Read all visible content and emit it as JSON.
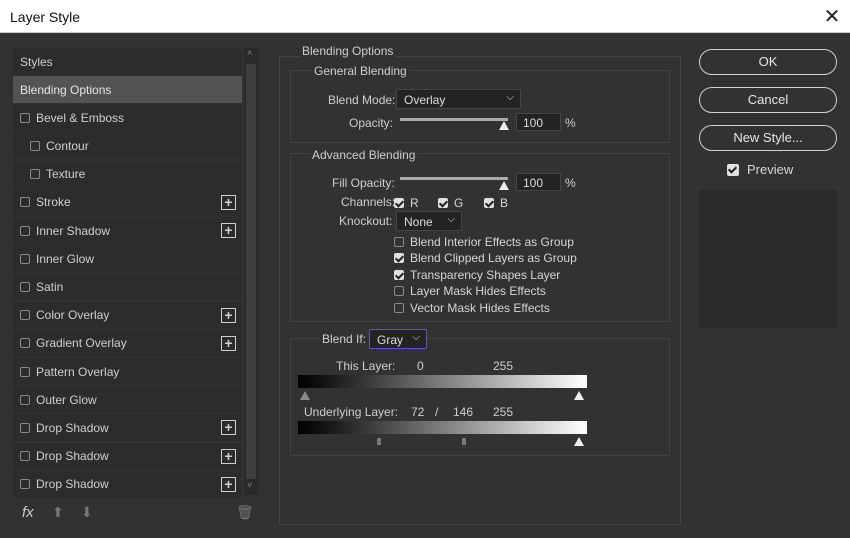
{
  "window": {
    "title": "Layer Style",
    "close_icon": "close-icon"
  },
  "styles_list": {
    "header": "Styles",
    "items": [
      {
        "label": "Blending Options",
        "selected": true
      },
      {
        "label": "Bevel & Emboss",
        "checkbox": true
      },
      {
        "label": "Contour",
        "checkbox": true,
        "indent": true
      },
      {
        "label": "Texture",
        "checkbox": true,
        "indent": true
      },
      {
        "label": "Stroke",
        "checkbox": true,
        "plus": true
      },
      {
        "label": "Inner Shadow",
        "checkbox": true,
        "plus": true
      },
      {
        "label": "Inner Glow",
        "checkbox": true
      },
      {
        "label": "Satin",
        "checkbox": true
      },
      {
        "label": "Color Overlay",
        "checkbox": true,
        "plus": true
      },
      {
        "label": "Gradient Overlay",
        "checkbox": true,
        "plus": true
      },
      {
        "label": "Pattern Overlay",
        "checkbox": true
      },
      {
        "label": "Outer Glow",
        "checkbox": true
      },
      {
        "label": "Drop Shadow",
        "checkbox": true,
        "plus": true
      },
      {
        "label": "Drop Shadow",
        "checkbox": true,
        "plus": true
      },
      {
        "label": "Drop Shadow",
        "checkbox": true,
        "plus": true
      }
    ],
    "fx_label": "fx"
  },
  "blending": {
    "title": "Blending Options",
    "general": {
      "title": "General Blending",
      "blend_mode_label": "Blend Mode:",
      "blend_mode": "Overlay",
      "opacity_label": "Opacity:",
      "opacity": "100",
      "pct": "%"
    },
    "advanced": {
      "title": "Advanced Blending",
      "fill_label": "Fill Opacity:",
      "fill": "100",
      "pct": "%",
      "channels_label": "Channels:",
      "r": "R",
      "g": "G",
      "b": "B",
      "knockout_label": "Knockout:",
      "knockout": "None",
      "options": [
        {
          "label": "Blend Interior Effects as Group",
          "checked": false
        },
        {
          "label": "Blend Clipped Layers as Group",
          "checked": true
        },
        {
          "label": "Transparency Shapes Layer",
          "checked": true
        },
        {
          "label": "Layer Mask Hides Effects",
          "checked": false
        },
        {
          "label": "Vector Mask Hides Effects",
          "checked": false
        }
      ]
    },
    "blend_if": {
      "label": "Blend If:",
      "value": "Gray",
      "this_layer_label": "This Layer:",
      "this_min": "0",
      "this_max": "255",
      "under_label": "Underlying Layer:",
      "under_a": "72",
      "slash": "/",
      "under_b": "146",
      "under_max": "255"
    }
  },
  "buttons": {
    "ok": "OK",
    "cancel": "Cancel",
    "new_style": "New Style...",
    "preview": "Preview"
  }
}
